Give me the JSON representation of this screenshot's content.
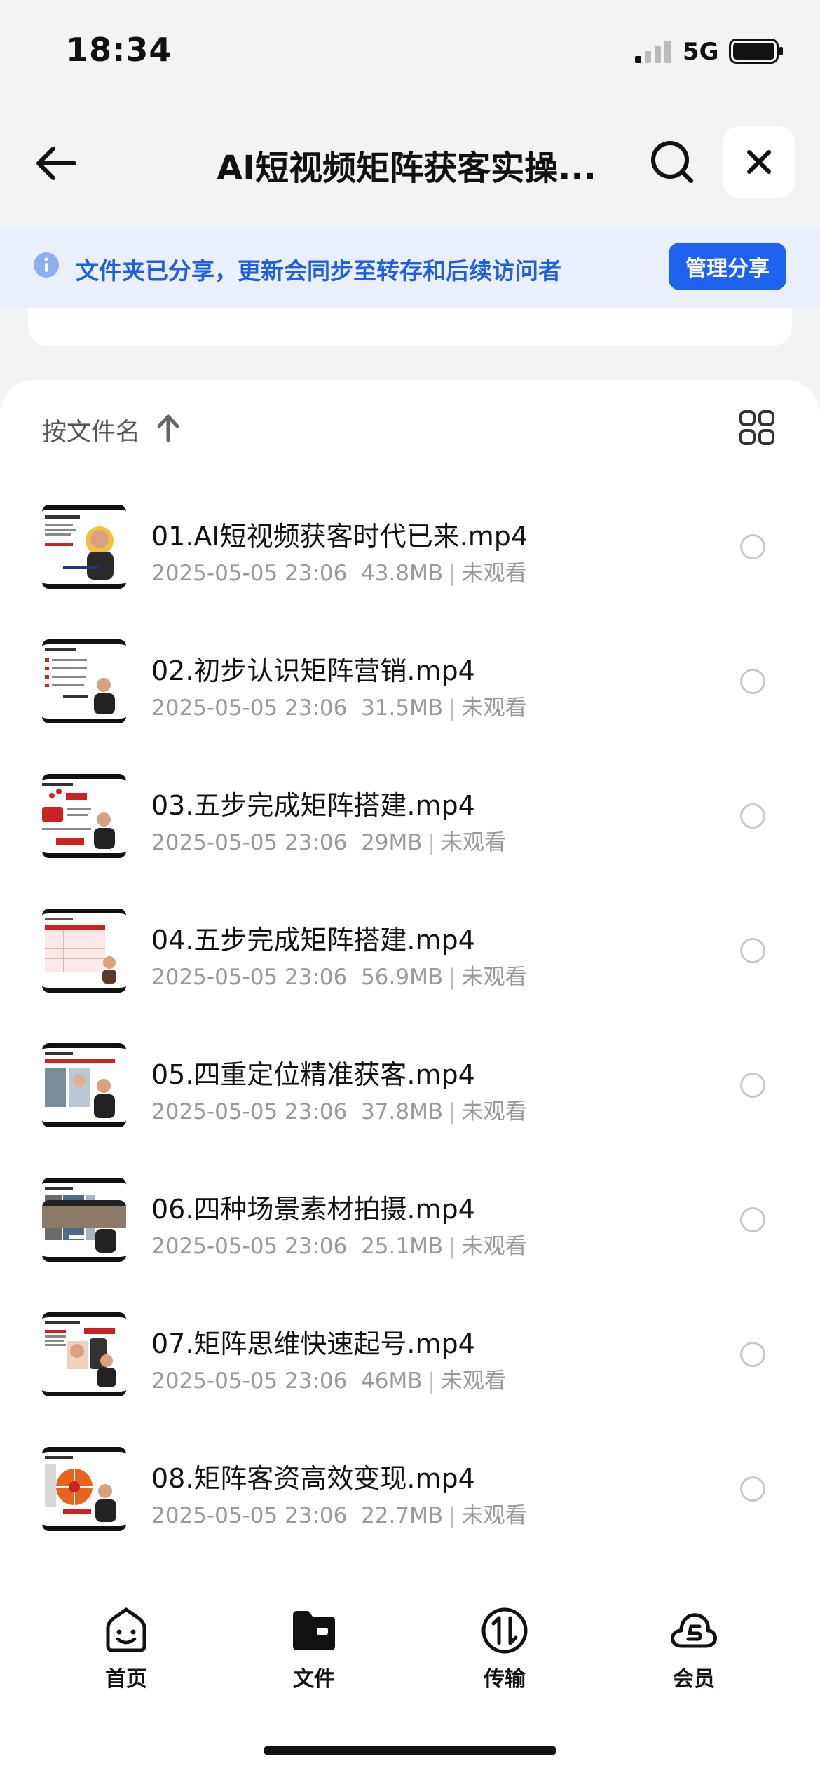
{
  "status_bar": {
    "time": "18:34",
    "network": "5G"
  },
  "nav": {
    "title": "AI短视频矩阵获客实操..."
  },
  "banner": {
    "text": "文件夹已分享，更新会同步至转存和后续访问者",
    "button": "管理分享"
  },
  "sort": {
    "label": "按文件名"
  },
  "files": [
    {
      "name": "01.AI短视频获客时代已来.mp4",
      "date": "2025-05-05 23:06",
      "size": "43.8MB",
      "status": "未观看"
    },
    {
      "name": "02.初步认识矩阵营销.mp4",
      "date": "2025-05-05 23:06",
      "size": "31.5MB",
      "status": "未观看"
    },
    {
      "name": "03.五步完成矩阵搭建.mp4",
      "date": "2025-05-05 23:06",
      "size": "29MB",
      "status": "未观看"
    },
    {
      "name": "04.五步完成矩阵搭建.mp4",
      "date": "2025-05-05 23:06",
      "size": "56.9MB",
      "status": "未观看"
    },
    {
      "name": "05.四重定位精准获客.mp4",
      "date": "2025-05-05 23:06",
      "size": "37.8MB",
      "status": "未观看"
    },
    {
      "name": "06.四种场景素材拍摄.mp4",
      "date": "2025-05-05 23:06",
      "size": "25.1MB",
      "status": "未观看"
    },
    {
      "name": "07.矩阵思维快速起号.mp4",
      "date": "2025-05-05 23:06",
      "size": "46MB",
      "status": "未观看"
    },
    {
      "name": "08.矩阵客资高效变现.mp4",
      "date": "2025-05-05 23:06",
      "size": "22.7MB",
      "status": "未观看"
    }
  ],
  "tabs": [
    {
      "label": "首页",
      "icon": "home-face-icon"
    },
    {
      "label": "文件",
      "icon": "folder-icon"
    },
    {
      "label": "传输",
      "icon": "transfer-icon"
    },
    {
      "label": "会员",
      "icon": "vip-cloud-icon"
    }
  ],
  "colors": {
    "accent": "#1e63f0",
    "banner_bg": "#e9effb",
    "banner_text": "#1f5fe0"
  }
}
